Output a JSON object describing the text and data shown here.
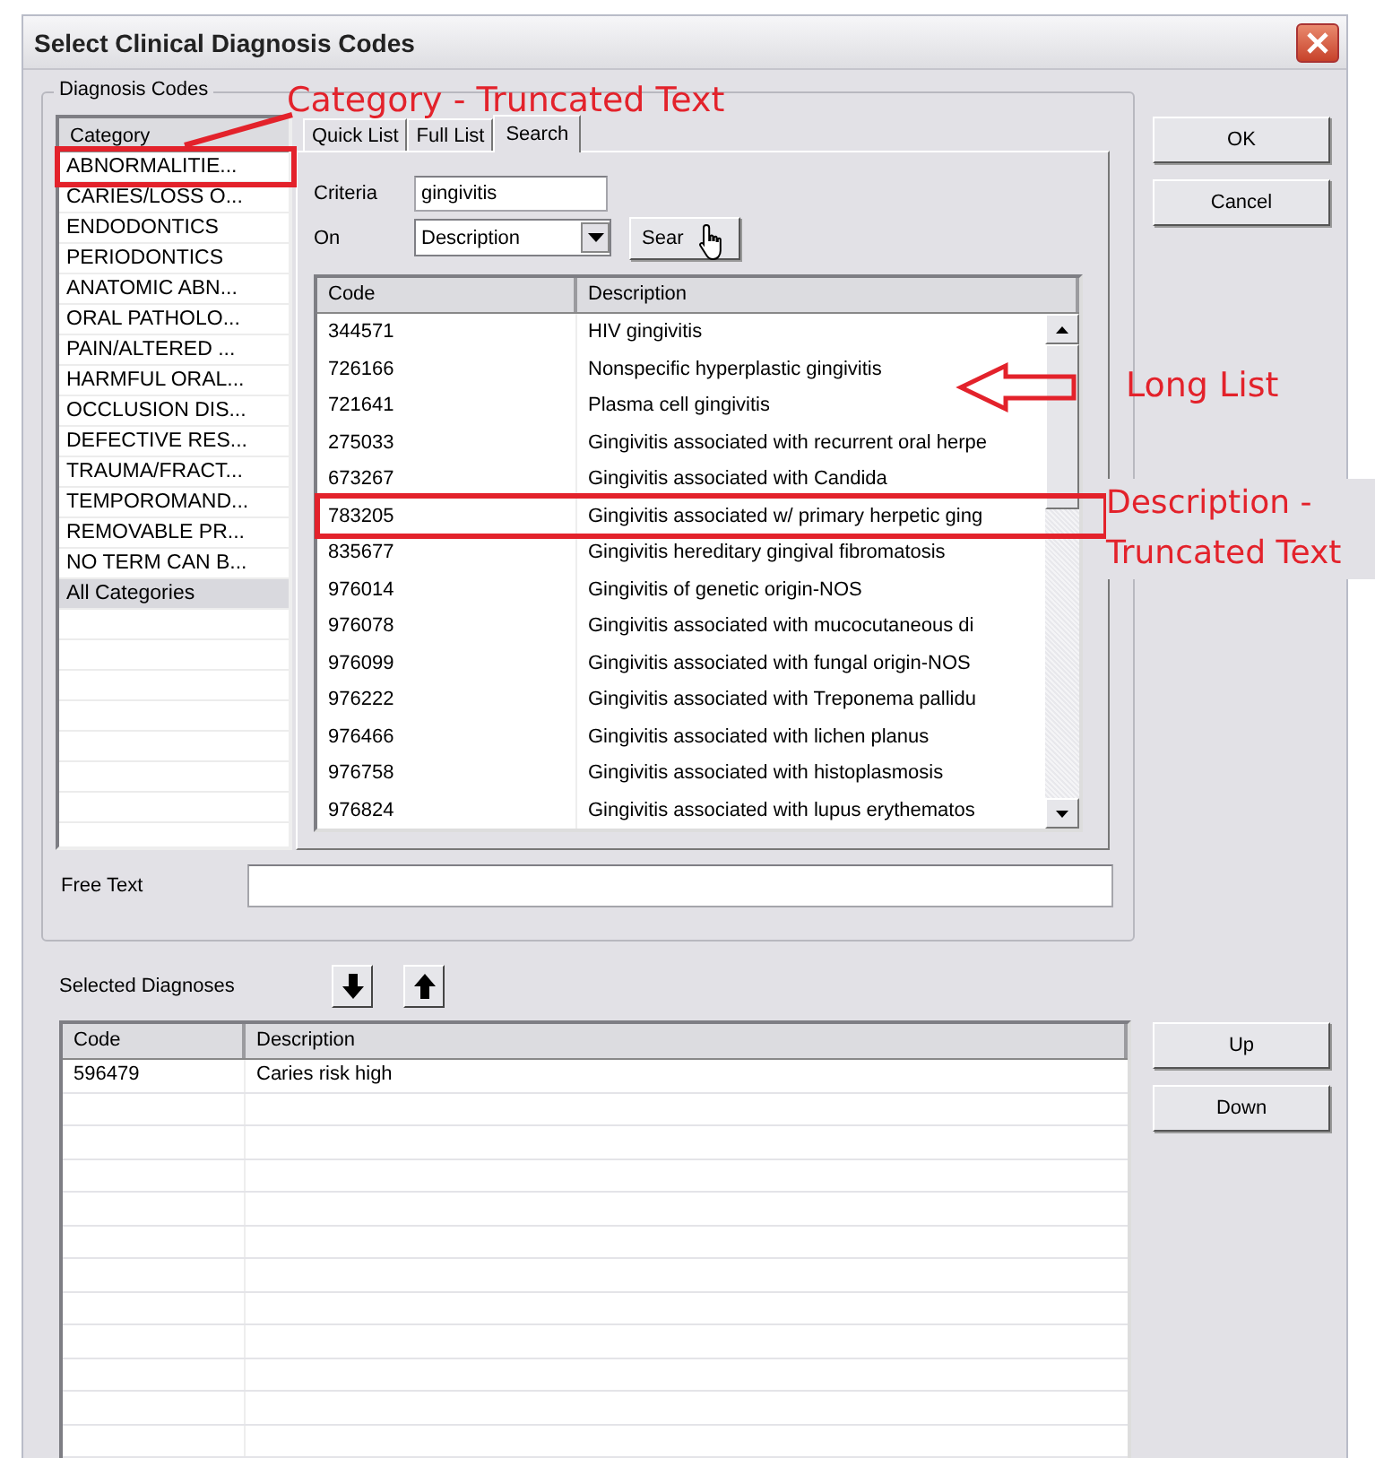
{
  "window": {
    "title": "Select Clinical Diagnosis Codes"
  },
  "diagnosis_codes": {
    "legend": "Diagnosis Codes",
    "category_list": {
      "header": "Category",
      "items": [
        {
          "label": "ABNORMALITIE...",
          "selected": false
        },
        {
          "label": "CARIES/LOSS O...",
          "selected": false
        },
        {
          "label": "ENDODONTICS",
          "selected": false
        },
        {
          "label": "PERIODONTICS",
          "selected": false
        },
        {
          "label": "ANATOMIC ABN...",
          "selected": false
        },
        {
          "label": "ORAL PATHOLO...",
          "selected": false
        },
        {
          "label": "PAIN/ALTERED ...",
          "selected": false
        },
        {
          "label": "HARMFUL ORAL...",
          "selected": false
        },
        {
          "label": "OCCLUSION DIS...",
          "selected": false
        },
        {
          "label": "DEFECTIVE RES...",
          "selected": false
        },
        {
          "label": "TRAUMA/FRACT...",
          "selected": false
        },
        {
          "label": "TEMPOROMAND...",
          "selected": false
        },
        {
          "label": "REMOVABLE PR...",
          "selected": false
        },
        {
          "label": "NO TERM CAN B...",
          "selected": false
        },
        {
          "label": "All Categories",
          "selected": true
        }
      ]
    },
    "tabs": [
      {
        "label": "Quick List",
        "selected": false
      },
      {
        "label": "Full List",
        "selected": false
      },
      {
        "label": "Search",
        "selected": true
      }
    ],
    "search": {
      "criteria_label": "Criteria",
      "criteria_value": "gingivitis",
      "on_label": "On",
      "on_value": "Description",
      "button": "Sear"
    },
    "results": {
      "columns": [
        "Code",
        "Description"
      ],
      "rows": [
        {
          "code": "344571",
          "description": "HIV gingivitis"
        },
        {
          "code": "726166",
          "description": "Nonspecific hyperplastic gingivitis"
        },
        {
          "code": "721641",
          "description": "Plasma cell gingivitis"
        },
        {
          "code": "275033",
          "description": "Gingivitis associated with recurrent oral herpe"
        },
        {
          "code": "673267",
          "description": "Gingivitis associated with Candida"
        },
        {
          "code": "783205",
          "description": "Gingivitis associated w/ primary herpetic ging"
        },
        {
          "code": "835677",
          "description": "Gingivitis hereditary gingival fibromatosis"
        },
        {
          "code": "976014",
          "description": "Gingivitis of genetic origin-NOS"
        },
        {
          "code": "976078",
          "description": "Gingivitis associated with mucocutaneous di"
        },
        {
          "code": "976099",
          "description": "Gingivitis associated with fungal origin-NOS"
        },
        {
          "code": "976222",
          "description": "Gingivitis associated with Treponema pallidu"
        },
        {
          "code": "976466",
          "description": "Gingivitis associated with lichen planus"
        },
        {
          "code": "976758",
          "description": "Gingivitis associated with histoplasmosis"
        },
        {
          "code": "976824",
          "description": "Gingivitis associated with lupus erythematos"
        }
      ]
    },
    "free_text": {
      "label": "Free Text"
    }
  },
  "selected_diagnoses": {
    "label": "Selected Diagnoses",
    "columns": [
      "Code",
      "Description"
    ],
    "rows": [
      {
        "code": "596479",
        "description": "Caries risk high"
      }
    ]
  },
  "buttons": [
    {
      "label": "OK"
    },
    {
      "label": "Cancel"
    }
  ],
  "order_buttons": [
    {
      "label": "Up"
    },
    {
      "label": "Down"
    }
  ],
  "annotations": [
    {
      "kind": "category",
      "text": "Category - Truncated Text"
    },
    {
      "kind": "list",
      "text": "Long List"
    },
    {
      "kind": "description",
      "text": "Description - Truncated Text"
    }
  ]
}
